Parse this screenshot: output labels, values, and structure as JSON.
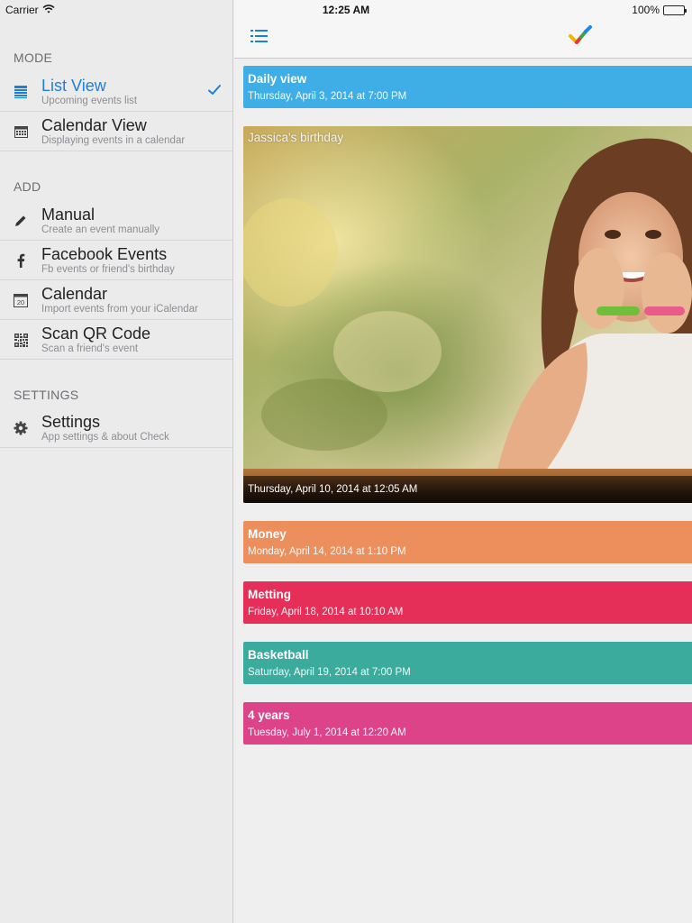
{
  "status_bar": {
    "carrier": "Carrier",
    "time": "12:25 AM",
    "battery": "100%"
  },
  "sidebar": {
    "sections": [
      {
        "header": "MODE"
      },
      {
        "header": "ADD"
      },
      {
        "header": "SETTINGS"
      }
    ],
    "items": [
      {
        "title": "List View",
        "subtitle": "Upcoming events list",
        "icon": "list-icon",
        "active": true
      },
      {
        "title": "Calendar View",
        "subtitle": "Displaying events in a calendar",
        "icon": "calendar-grid-icon"
      },
      {
        "title": "Manual",
        "subtitle": "Create an event manually",
        "icon": "pencil-icon"
      },
      {
        "title": "Facebook Events",
        "subtitle": "Fb events or friend's birthday",
        "icon": "facebook-icon"
      },
      {
        "title": "Calendar",
        "subtitle": "Import events from your iCalendar",
        "icon": "calendar-day-icon",
        "icon_text": "20"
      },
      {
        "title": "Scan QR Code",
        "subtitle": "Scan a friend's event",
        "icon": "qr-code-icon"
      },
      {
        "title": "Settings",
        "subtitle": "App settings & about Check",
        "icon": "gear-icon"
      }
    ]
  },
  "colors": {
    "accent_blue": "#1e7fd8",
    "daily_view": "#3faee6",
    "money": "#ec8f5c",
    "metting": "#e62f58",
    "basketball": "#3aab9d",
    "four_years": "#dc4388"
  },
  "events": [
    {
      "title": "Daily view",
      "date": "Thursday, April 3, 2014 at 7:00 PM",
      "color": "#3faee6"
    },
    {
      "title": "Jassica's birthday",
      "date": "Thursday, April 10, 2014 at 12:05 AM",
      "photo": true
    },
    {
      "title": "Money",
      "date": "Monday, April 14, 2014 at 1:10 PM",
      "color": "#ec8f5c"
    },
    {
      "title": "Metting",
      "date": "Friday, April 18, 2014 at 10:10 AM",
      "color": "#e62f58"
    },
    {
      "title": "Basketball",
      "date": "Saturday, April 19, 2014 at 7:00 PM",
      "color": "#3aab9d"
    },
    {
      "title": "4 years",
      "date": "Tuesday, July 1, 2014 at 12:20 AM",
      "color": "#dc4388"
    }
  ]
}
